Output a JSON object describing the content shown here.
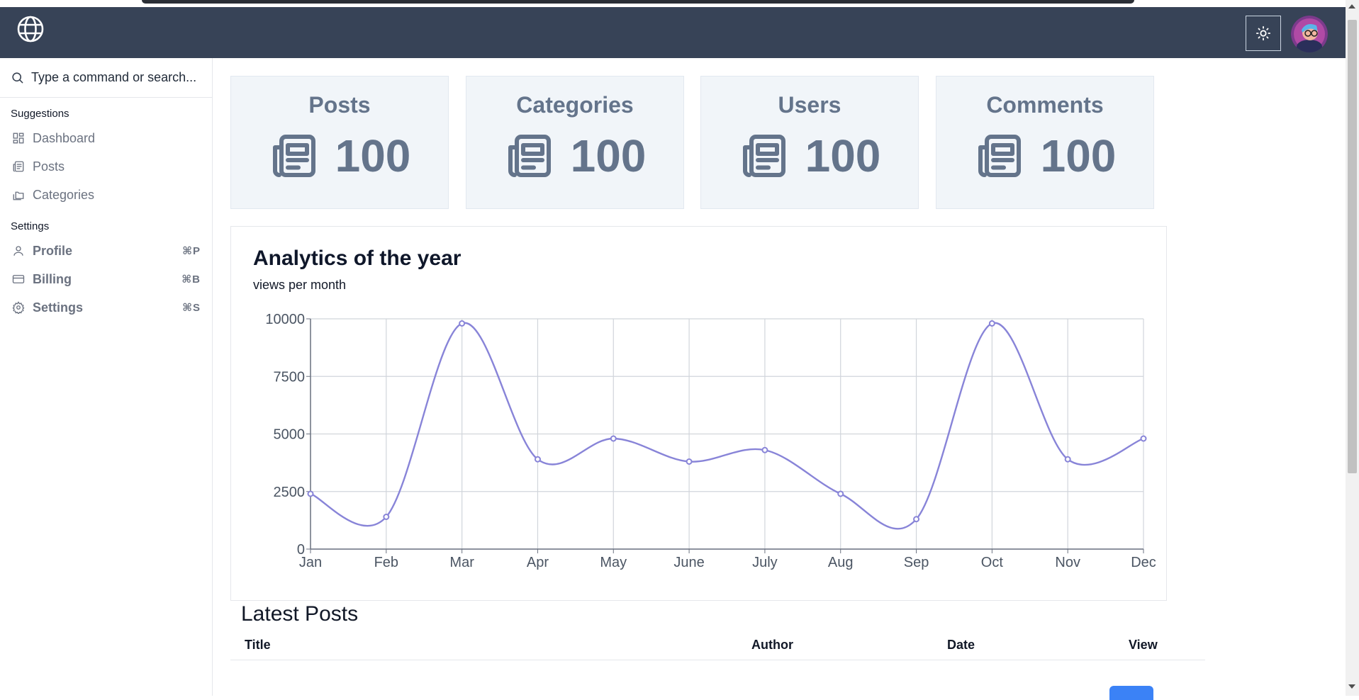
{
  "sidebar": {
    "search_placeholder": "Type a command or search...",
    "groups": [
      {
        "title": "Suggestions",
        "items": [
          {
            "label": "Dashboard",
            "icon": "dashboard-icon"
          },
          {
            "label": "Posts",
            "icon": "newspaper-icon"
          },
          {
            "label": "Categories",
            "icon": "folders-icon"
          }
        ]
      },
      {
        "title": "Settings",
        "items": [
          {
            "label": "Profile",
            "icon": "user-icon",
            "shortcut": "⌘P"
          },
          {
            "label": "Billing",
            "icon": "credit-card-icon",
            "shortcut": "⌘B"
          },
          {
            "label": "Settings",
            "icon": "gear-icon",
            "shortcut": "⌘S"
          }
        ]
      }
    ]
  },
  "stats": [
    {
      "label": "Posts",
      "value": "100"
    },
    {
      "label": "Categories",
      "value": "100"
    },
    {
      "label": "Users",
      "value": "100"
    },
    {
      "label": "Comments",
      "value": "100"
    }
  ],
  "chart": {
    "title": "Analytics of the year",
    "subtitle": "views per month"
  },
  "chart_data": {
    "type": "line",
    "categories": [
      "Jan",
      "Feb",
      "Mar",
      "Apr",
      "May",
      "June",
      "July",
      "Aug",
      "Sep",
      "Oct",
      "Nov",
      "Dec"
    ],
    "series": [
      {
        "values": [
          2400,
          1400,
          9800,
          3900,
          4800,
          3800,
          4300,
          2400,
          1300,
          9800,
          3900,
          4800
        ]
      }
    ],
    "ylim": [
      0,
      10000
    ],
    "yticks": [
      "0",
      "2500",
      "5000",
      "7500",
      "10000"
    ],
    "grid": true,
    "line_color": "#8884d8"
  },
  "latest": {
    "title": "Latest Posts",
    "columns": [
      "Title",
      "Author",
      "Date",
      "View"
    ]
  }
}
